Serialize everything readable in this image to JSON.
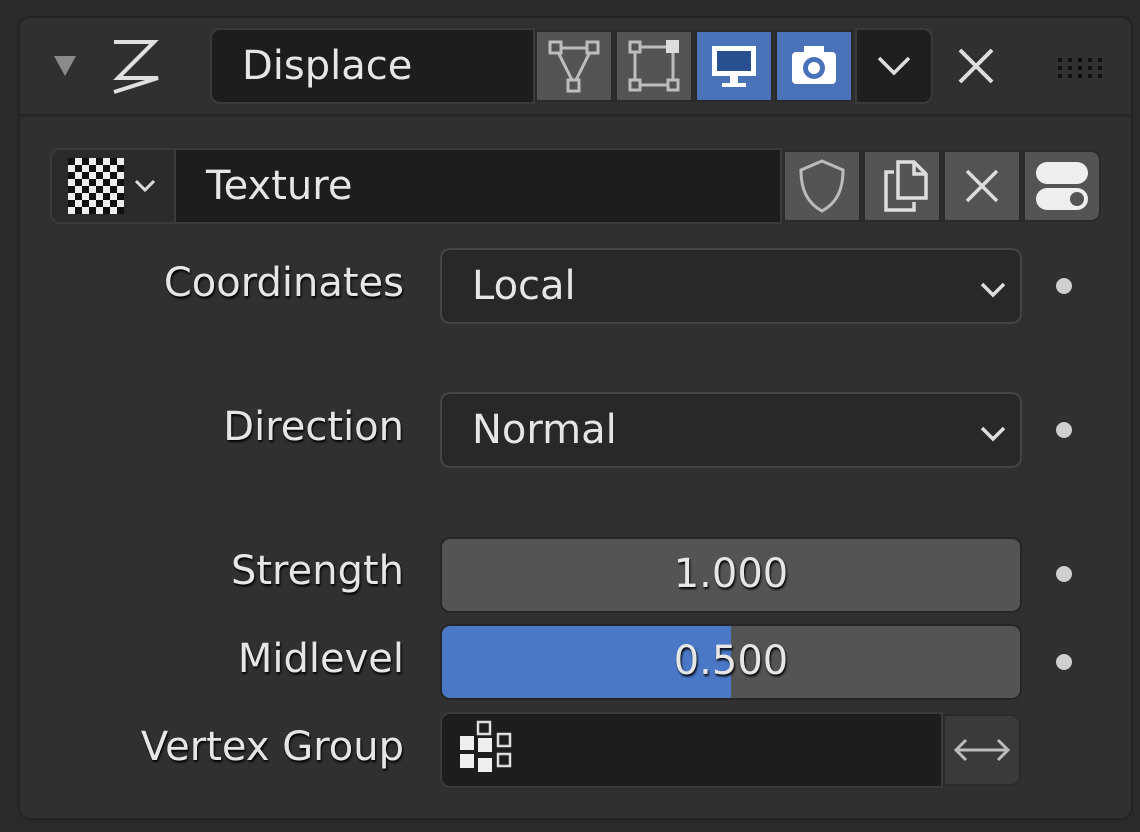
{
  "modifier": {
    "name": "Displace",
    "edit_mode_active": false,
    "cage_active": false,
    "viewport_active": true,
    "render_active": true
  },
  "texture": {
    "name": "Texture"
  },
  "fields": {
    "coordinates": {
      "label": "Coordinates",
      "value": "Local"
    },
    "direction": {
      "label": "Direction",
      "value": "Normal"
    },
    "strength": {
      "label": "Strength",
      "value": "1.000"
    },
    "midlevel": {
      "label": "Midlevel",
      "value": "0.500",
      "fraction": 0.5
    },
    "vertex_group": {
      "label": "Vertex Group",
      "value": ""
    }
  },
  "colors": {
    "accent": "#4a72b9",
    "panel": "#303030"
  }
}
